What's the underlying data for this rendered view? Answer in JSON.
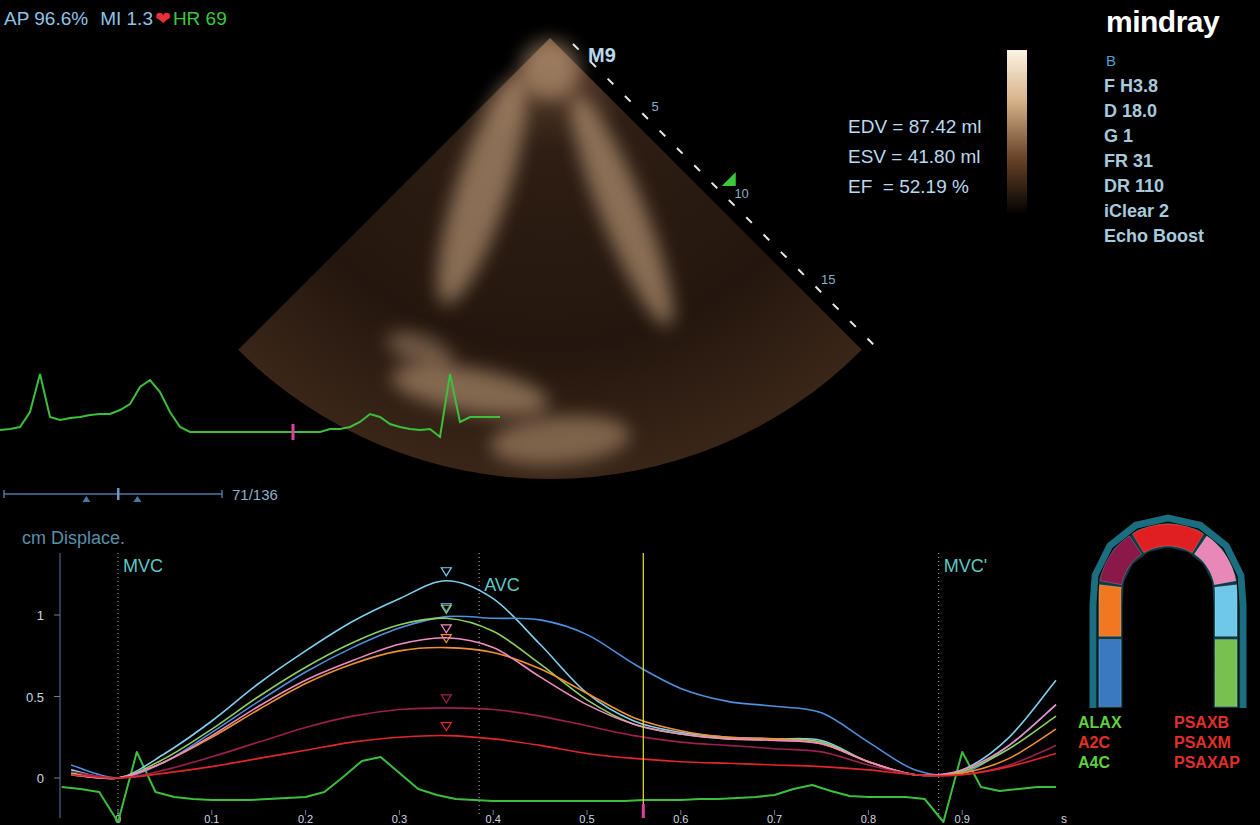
{
  "status": {
    "ap": "AP 96.6%",
    "mi": "MI 1.3",
    "heart_icon": "❤",
    "hr": "HR 69"
  },
  "logo": "mindray",
  "params": [
    "B",
    "F H3.8",
    "D 18.0",
    "G 1",
    "FR 31",
    "DR 110",
    "iClear 2",
    "Echo Boost"
  ],
  "probe": "M9",
  "depth_marks": [
    "5",
    "10",
    "15"
  ],
  "measurements": [
    "EDV = 87.42 ml",
    "ESV = 41.80 ml",
    "EF  = 52.19 %"
  ],
  "frame_counter": "71/136",
  "scrub": {
    "level": 0.523,
    "range_start": 0.378,
    "range_end": 0.612
  },
  "ecg_top": {
    "values": [
      2,
      3,
      5,
      20,
      58,
      15,
      12,
      14,
      15,
      17,
      18,
      18,
      22,
      28,
      45,
      52,
      40,
      20,
      5,
      0,
      0,
      0,
      0,
      0,
      0,
      0,
      0,
      0,
      0,
      0,
      0,
      0,
      0,
      3,
      3,
      5,
      10,
      18,
      15,
      8,
      5,
      3,
      2,
      3,
      -5,
      58,
      10,
      15,
      15,
      15,
      15
    ],
    "marker": 0.586
  },
  "chart": {
    "title": "cm Displace.",
    "y_ticks": [
      "0",
      "0.5",
      "1"
    ],
    "x_ticks": [
      "0",
      "0.1",
      "0.2",
      "0.3",
      "0.4",
      "0.5",
      "0.6",
      "0.7",
      "0.8",
      "0.9"
    ],
    "x_unit": "s",
    "events": [
      {
        "label": "MVC",
        "t": 0
      },
      {
        "label": "AVC",
        "t": 0.385
      },
      {
        "label": "MVC'",
        "t": 0.875
      }
    ],
    "cursor_t": 0.56,
    "t_start": -0.05,
    "t_step": 0.05,
    "series": [
      {
        "color": "#7fd0ee",
        "values": [
          0.05,
          0,
          0.15,
          0.35,
          0.58,
          0.78,
          0.96,
          1.1,
          1.21,
          1.1,
          0.82,
          0.52,
          0.35,
          0.28,
          0.25,
          0.24,
          0.23,
          0.1,
          0.02,
          0.05,
          0.25,
          0.6
        ]
      },
      {
        "color": "#4f8fdc",
        "values": [
          0.08,
          0,
          0.1,
          0.28,
          0.47,
          0.65,
          0.8,
          0.92,
          0.99,
          0.98,
          0.97,
          0.88,
          0.7,
          0.55,
          0.47,
          0.44,
          0.4,
          0.22,
          0.05,
          0.03,
          0.2,
          0.45
        ]
      },
      {
        "color": "#8fd060",
        "values": [
          0.03,
          0,
          0.12,
          0.3,
          0.5,
          0.68,
          0.83,
          0.94,
          0.98,
          0.9,
          0.7,
          0.48,
          0.33,
          0.27,
          0.24,
          0.24,
          0.22,
          0.1,
          0.02,
          0.04,
          0.18,
          0.38
        ]
      },
      {
        "color": "#f09030",
        "values": [
          0.02,
          0,
          0.1,
          0.25,
          0.42,
          0.58,
          0.7,
          0.78,
          0.8,
          0.77,
          0.67,
          0.52,
          0.37,
          0.29,
          0.25,
          0.24,
          0.21,
          0.1,
          0.02,
          0.03,
          0.12,
          0.3
        ]
      },
      {
        "color": "#f08cc0",
        "values": [
          0.02,
          0,
          0.1,
          0.26,
          0.44,
          0.6,
          0.72,
          0.82,
          0.86,
          0.8,
          0.62,
          0.45,
          0.33,
          0.27,
          0.24,
          0.23,
          0.21,
          0.1,
          0.02,
          0.05,
          0.2,
          0.45
        ]
      },
      {
        "color": "#9a2050",
        "values": [
          0.04,
          0,
          0.05,
          0.13,
          0.22,
          0.31,
          0.38,
          0.42,
          0.43,
          0.42,
          0.38,
          0.32,
          0.26,
          0.22,
          0.2,
          0.18,
          0.16,
          0.08,
          0.02,
          0.02,
          0.08,
          0.2
        ]
      },
      {
        "color": "#e02828",
        "values": [
          0.02,
          0,
          0.03,
          0.07,
          0.12,
          0.17,
          0.22,
          0.25,
          0.26,
          0.24,
          0.2,
          0.15,
          0.12,
          0.1,
          0.09,
          0.08,
          0.07,
          0.05,
          0.02,
          0.02,
          0.07,
          0.15
        ]
      }
    ],
    "ecg": {
      "t_start": -0.06,
      "t_step": 0.02,
      "values": [
        10,
        8,
        5,
        -25,
        45,
        5,
        0,
        -2,
        -3,
        -3,
        -3,
        -2,
        -1,
        0,
        5,
        20,
        36,
        40,
        24,
        8,
        2,
        -2,
        -3,
        -4,
        -4,
        -4,
        -4,
        -4,
        -4,
        -4,
        -4,
        -3,
        -3,
        -3,
        -2,
        -2,
        -1,
        0,
        2,
        8,
        12,
        6,
        1,
        0,
        0,
        0,
        -2,
        -25,
        45,
        10,
        6,
        8,
        10,
        10
      ]
    }
  },
  "segments": [
    {
      "color": "#3a78c0"
    },
    {
      "color": "#f07820"
    },
    {
      "color": "#8a1848"
    },
    {
      "color": "#e02020"
    },
    {
      "color": "#e888b8"
    },
    {
      "color": "#70c8e8"
    },
    {
      "color": "#78c050"
    }
  ],
  "legend": [
    {
      "label": "ALAX",
      "color": "#5fcf3f"
    },
    {
      "label": "PSAXB",
      "color": "#e0302a"
    },
    {
      "label": "A2C",
      "color": "#e0302a"
    },
    {
      "label": "PSAXM",
      "color": "#e0302a"
    },
    {
      "label": "A4C",
      "color": "#5fcf3f"
    },
    {
      "label": "PSAXAP",
      "color": "#e0302a"
    }
  ]
}
